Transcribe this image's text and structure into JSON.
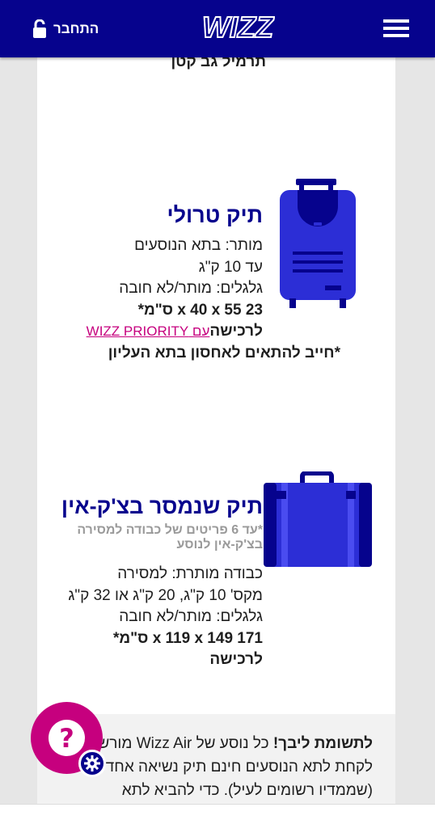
{
  "header": {
    "login_label": "התחבר",
    "logo_text": "WIZZ"
  },
  "top_clipped_text": "תרמיל גב קטן",
  "trolley": {
    "title": "תיק טרולי",
    "line1": "מותר: בתא הנוסעים",
    "line2": "עד 10 ק\"ג",
    "line3": "גלגלים: מותר/לא חובה",
    "dimensions": "23 x 40 x 55 ס\"מ*",
    "purchase_label": "לרכישה",
    "priority_link": "עם WIZZ PRIORITY",
    "fit_note": "*חייב להתאים לאחסון בתא העליון"
  },
  "checked": {
    "title": "תיק שנמסר בצ'ק-אין",
    "note_line1": "*עד 6 פריטים של כבודה למסירה",
    "note_line2": "בצ'ק-אין לנוסע",
    "line1": "כבודה מותרת: למסירה",
    "line2": "מקס' 10 ק\"ג, 20 ק\"ג או 32 ק\"ג",
    "line3": "גלגלים: מותר/לא חובה",
    "dimensions": "171 x 119 x 149 ס\"מ*",
    "purchase_label": "לרכישה"
  },
  "attention": {
    "bold_prefix": "לתשומת ליבך!",
    "line1_rest": " כל נוסע של Wizz Air מורשה",
    "line2": "לקחת לתא הנוסעים חינם תיק נשיאה אחד",
    "line3": "(שממדיו רשומים לעיל). כדי להביא לתא"
  },
  "help": {
    "symbol": "?"
  },
  "colors": {
    "brand_blue": "#06038d",
    "brand_pink": "#c6007e",
    "bag_blue": "#2c2ed6"
  },
  "icons": {
    "login": "unlock-icon",
    "menu": "hamburger-menu-icon",
    "trolley": "trolley-bag-icon",
    "checked": "suitcase-icon",
    "help": "question-icon",
    "settings": "gear-icon"
  }
}
